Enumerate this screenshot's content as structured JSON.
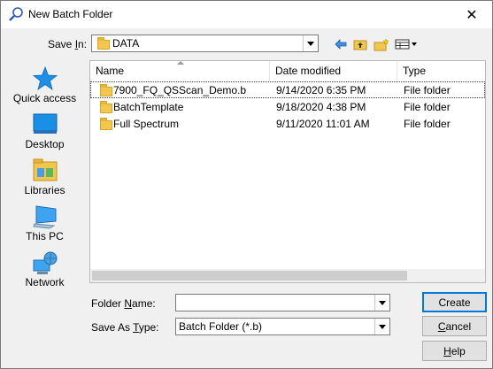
{
  "window": {
    "title": "New Batch Folder",
    "close_glyph": "✕"
  },
  "toolbar": {
    "save_in_label_pre": "Save ",
    "save_in_label_key": "I",
    "save_in_label_post": "n:",
    "save_in_value": "DATA",
    "icons": [
      "back-arrow-icon",
      "up-folder-icon",
      "new-folder-icon",
      "view-menu-icon"
    ]
  },
  "places": [
    {
      "label": "Quick access",
      "icon": "quick-access-star-icon"
    },
    {
      "label": "Desktop",
      "icon": "desktop-icon"
    },
    {
      "label": "Libraries",
      "icon": "libraries-icon"
    },
    {
      "label": "This PC",
      "icon": "this-pc-icon"
    },
    {
      "label": "Network",
      "icon": "network-icon"
    }
  ],
  "filelist": {
    "columns": [
      "Name",
      "Date modified",
      "Type"
    ],
    "rows": [
      {
        "name": "7900_FQ_QSScan_Demo.b",
        "date": "9/14/2020 6:35 PM",
        "type": "File folder"
      },
      {
        "name": "BatchTemplate",
        "date": "9/18/2020 4:38 PM",
        "type": "File folder"
      },
      {
        "name": "Full Spectrum",
        "date": "9/11/2020 11:01 AM",
        "type": "File folder"
      }
    ]
  },
  "form": {
    "folder_name_pre": "Folder ",
    "folder_name_key": "N",
    "folder_name_post": "ame:",
    "folder_name_value": "",
    "save_as_pre": "Save As ",
    "save_as_key": "T",
    "save_as_post": "ype:",
    "save_as_value": "Batch Folder (*.b)"
  },
  "buttons": {
    "create": "Create",
    "cancel_key": "C",
    "cancel_rest": "ancel",
    "help_key": "H",
    "help_rest": "elp"
  },
  "colors": {
    "accent": "#0078d7",
    "folder": "#f3c74c",
    "window_bg": "#f0f0f0"
  }
}
